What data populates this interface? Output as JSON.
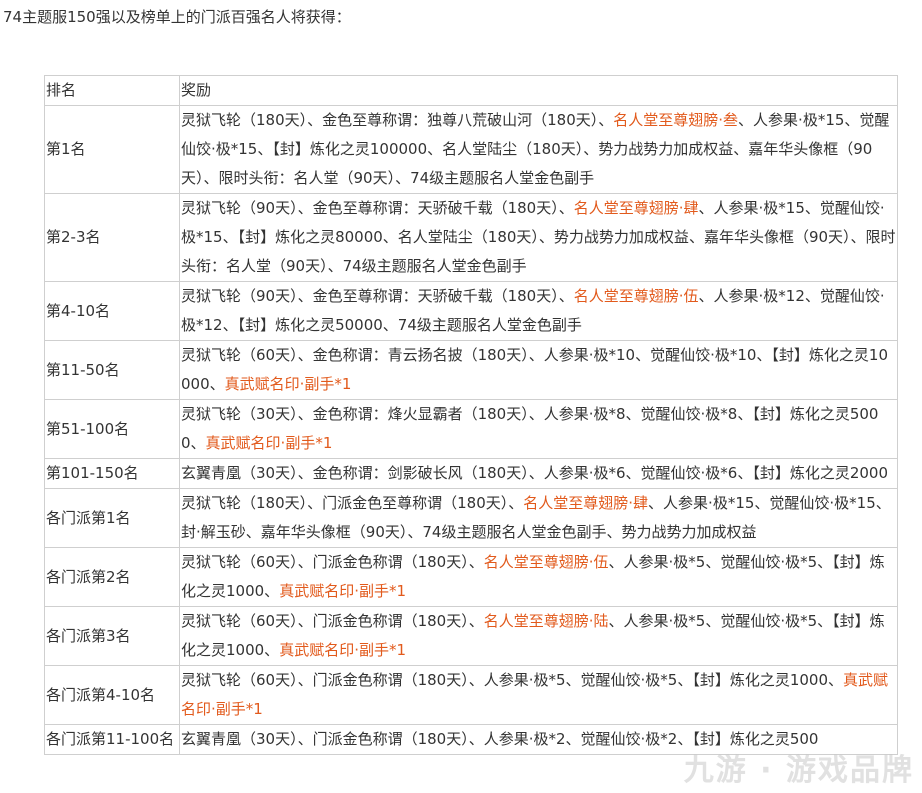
{
  "intro": "74主题服150强以及榜单上的门派百强名人将获得：",
  "table": {
    "headers": [
      "排名",
      "奖励"
    ],
    "rows": [
      {
        "rank": "第1名",
        "parts": [
          {
            "t": "灵狱飞轮（180天）、金色至尊称谓：独尊八荒破山河（180天）、",
            "h": false
          },
          {
            "t": "名人堂至尊翅膀·叁",
            "h": true
          },
          {
            "t": "、人参果·极*15、觉醒仙饺·极*15、【封】炼化之灵100000、名人堂陆尘（180天）、势力战势力加成权益、嘉年华头像框（90天）、限时头衔：名人堂（90天）、74级主题服名人堂金色副手",
            "h": false
          }
        ]
      },
      {
        "rank": "第2-3名",
        "parts": [
          {
            "t": "灵狱飞轮（90天）、金色至尊称谓：天骄破千载（180天）、",
            "h": false
          },
          {
            "t": "名人堂至尊翅膀·肆",
            "h": true
          },
          {
            "t": "、人参果·极*15、觉醒仙饺·极*15、【封】炼化之灵80000、名人堂陆尘（180天）、势力战势力加成权益、嘉年华头像框（90天）、限时头衔：名人堂（90天）、74级主题服名人堂金色副手",
            "h": false
          }
        ]
      },
      {
        "rank": "第4-10名",
        "parts": [
          {
            "t": "灵狱飞轮（90天）、金色至尊称谓：天骄破千载（180天）、",
            "h": false
          },
          {
            "t": "名人堂至尊翅膀·伍",
            "h": true
          },
          {
            "t": "、人参果·极*12、觉醒仙饺·极*12、【封】炼化之灵50000、74级主题服名人堂金色副手",
            "h": false
          }
        ]
      },
      {
        "rank": "第11-50名",
        "parts": [
          {
            "t": "灵狱飞轮（60天）、金色称谓：青云扬名披（180天）、人参果·极*10、觉醒仙饺·极*10、【封】炼化之灵10000、",
            "h": false
          },
          {
            "t": "真武赋名印·副手*1",
            "h": true
          }
        ]
      },
      {
        "rank": "第51-100名",
        "parts": [
          {
            "t": "灵狱飞轮（30天）、金色称谓：烽火显霸者（180天）、人参果·极*8、觉醒仙饺·极*8、【封】炼化之灵5000、",
            "h": false
          },
          {
            "t": "真武赋名印·副手*1",
            "h": true
          }
        ]
      },
      {
        "rank": "第101-150名",
        "parts": [
          {
            "t": "玄翼青凰（30天）、金色称谓：剑影破长风（180天）、人参果·极*6、觉醒仙饺·极*6、【封】炼化之灵2000",
            "h": false
          }
        ]
      },
      {
        "rank": "各门派第1名",
        "parts": [
          {
            "t": "灵狱飞轮（180天）、门派金色至尊称谓（180天）、",
            "h": false
          },
          {
            "t": "名人堂至尊翅膀·肆",
            "h": true
          },
          {
            "t": "、人参果·极*15、觉醒仙饺·极*15、封·解玉砂、嘉年华头像框（90天）、74级主题服名人堂金色副手、势力战势力加成权益",
            "h": false
          }
        ]
      },
      {
        "rank": "各门派第2名",
        "parts": [
          {
            "t": "灵狱飞轮（60天）、门派金色称谓（180天）、",
            "h": false
          },
          {
            "t": "名人堂至尊翅膀·伍",
            "h": true
          },
          {
            "t": "、人参果·极*5、觉醒仙饺·极*5、【封】炼化之灵1000、",
            "h": false
          },
          {
            "t": "真武赋名印·副手*1",
            "h": true
          }
        ]
      },
      {
        "rank": "各门派第3名",
        "parts": [
          {
            "t": "灵狱飞轮（60天）、门派金色称谓（180天）、",
            "h": false
          },
          {
            "t": "名人堂至尊翅膀·陆",
            "h": true
          },
          {
            "t": "、人参果·极*5、觉醒仙饺·极*5、【封】炼化之灵1000、",
            "h": false
          },
          {
            "t": "真武赋名印·副手*1",
            "h": true
          }
        ]
      },
      {
        "rank": "各门派第4-10名",
        "parts": [
          {
            "t": "灵狱飞轮（60天）、门派金色称谓（180天）、人参果·极*5、觉醒仙饺·极*5、【封】炼化之灵1000、",
            "h": false
          },
          {
            "t": "真武赋名印·副手*1",
            "h": true
          }
        ]
      },
      {
        "rank": "各门派第11-100名",
        "parts": [
          {
            "t": "玄翼青凰（30天）、门派金色称谓（180天）、人参果·极*2、觉醒仙饺·极*2、【封】炼化之灵500",
            "h": false
          }
        ]
      }
    ]
  },
  "watermark": "九游 · 游戏品牌",
  "colors": {
    "highlight": "#e25a1c",
    "text": "#333333",
    "border": "#cfcfcf"
  }
}
